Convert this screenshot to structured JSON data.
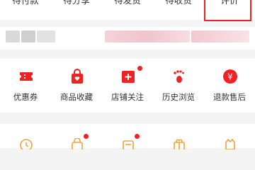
{
  "order_status": {
    "tabs": [
      {
        "label": "待付款"
      },
      {
        "label": "待分享"
      },
      {
        "label": "待发货"
      },
      {
        "label": "待收货"
      },
      {
        "label": "评价"
      }
    ]
  },
  "shortcuts": {
    "items": [
      {
        "label": "优惠券",
        "icon": "coupon-icon",
        "badge": false
      },
      {
        "label": "商品收藏",
        "icon": "favorite-bag-icon",
        "badge": false
      },
      {
        "label": "店铺关注",
        "icon": "store-follow-icon",
        "badge": true
      },
      {
        "label": "历史浏览",
        "icon": "footprint-icon",
        "badge": false
      },
      {
        "label": "退款售后",
        "icon": "refund-icon",
        "badge": false
      }
    ]
  },
  "bottom_row": {
    "icons": [
      "clock-icon",
      "bag-icon",
      "wallet-icon",
      "gift-icon",
      "cat-icon"
    ]
  },
  "colors": {
    "accent": "#e22222",
    "icon_orange": "#f0a23a",
    "text": "#333333"
  }
}
